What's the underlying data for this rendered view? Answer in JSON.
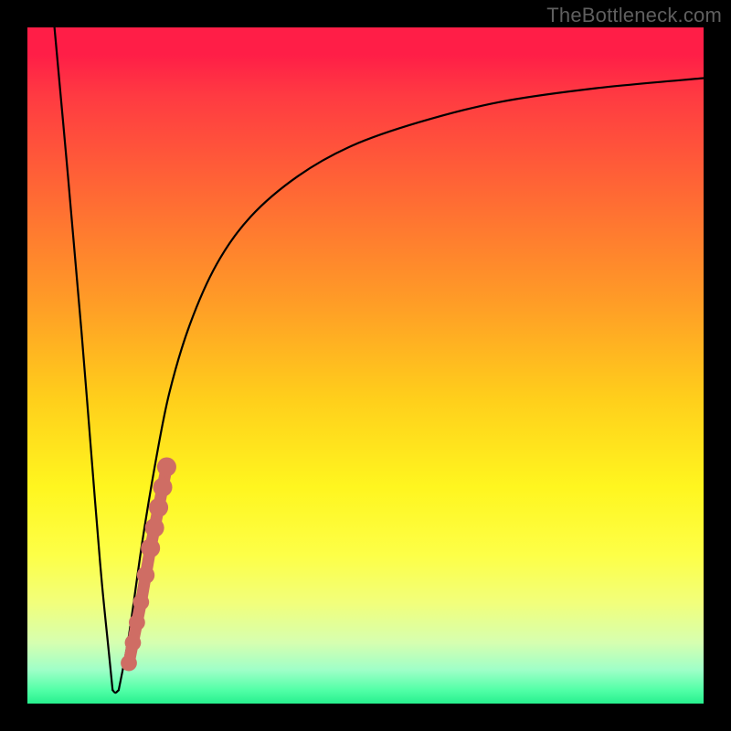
{
  "watermark": {
    "text": "TheBottleneck.com"
  },
  "colors": {
    "marker": "#cf6d64",
    "curve": "#000000"
  },
  "chart_data": {
    "type": "line",
    "title": "",
    "xlabel": "",
    "ylabel": "",
    "xlim": [
      0,
      100
    ],
    "ylim": [
      0,
      100
    ],
    "grid": false,
    "legend": false,
    "series": [
      {
        "name": "left-descent",
        "x": [
          4,
          6,
          8,
          10,
          11,
          12,
          12.6
        ],
        "y": [
          100,
          78,
          55,
          30,
          18,
          8,
          2
        ]
      },
      {
        "name": "right-ascent",
        "x": [
          13.5,
          15,
          17,
          19,
          21,
          24,
          28,
          33,
          40,
          48,
          58,
          70,
          84,
          100
        ],
        "y": [
          2,
          10,
          24,
          36,
          46,
          56,
          65,
          72,
          78,
          82.5,
          86,
          89,
          91,
          92.5
        ]
      },
      {
        "name": "valley-floor",
        "x": [
          12.6,
          13,
          13.5
        ],
        "y": [
          2,
          1.6,
          2
        ]
      }
    ],
    "markers": {
      "name": "highlighted-segment",
      "points": [
        {
          "x": 15.0,
          "y": 6.0,
          "r": 1.2
        },
        {
          "x": 15.6,
          "y": 9.0,
          "r": 1.2
        },
        {
          "x": 16.2,
          "y": 12.0,
          "r": 1.2
        },
        {
          "x": 16.8,
          "y": 15.0,
          "r": 1.2
        },
        {
          "x": 17.5,
          "y": 19.0,
          "r": 1.4
        },
        {
          "x": 18.2,
          "y": 23.0,
          "r": 1.6
        },
        {
          "x": 18.8,
          "y": 26.0,
          "r": 1.6
        },
        {
          "x": 19.4,
          "y": 29.0,
          "r": 1.6
        },
        {
          "x": 20.0,
          "y": 32.0,
          "r": 1.6
        },
        {
          "x": 20.6,
          "y": 35.0,
          "r": 1.6
        }
      ]
    },
    "gradient_stops": [
      {
        "pos": 0,
        "color": "#ff1e47"
      },
      {
        "pos": 25,
        "color": "#ff6a34"
      },
      {
        "pos": 55,
        "color": "#ffcf1b"
      },
      {
        "pos": 78,
        "color": "#fdff47"
      },
      {
        "pos": 95,
        "color": "#9fffc8"
      },
      {
        "pos": 100,
        "color": "#27f08e"
      }
    ]
  }
}
